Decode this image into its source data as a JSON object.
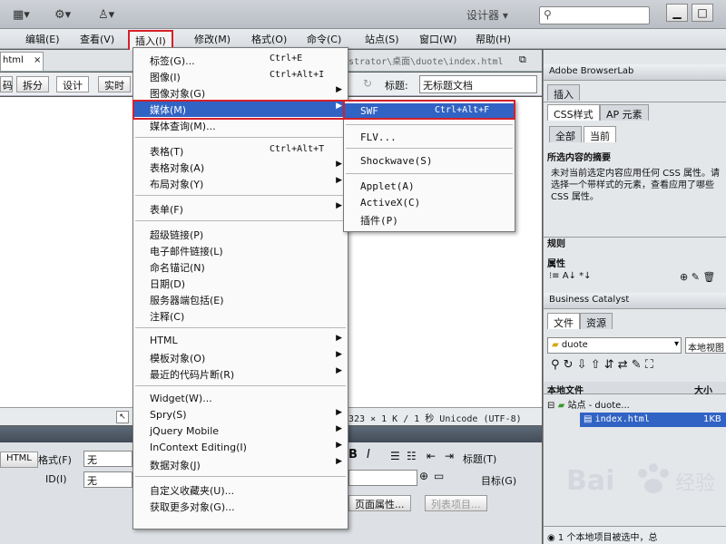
{
  "titlebar": {
    "designer": "设计器"
  },
  "menubar": {
    "items": [
      "编辑(E)",
      "查看(V)",
      "插入(I)",
      "修改(M)",
      "格式(O)",
      "命令(C)",
      "站点(S)",
      "窗口(W)",
      "帮助(H)"
    ]
  },
  "docbar": {
    "tab": "html",
    "path": "strator\\桌面\\duote\\index.html"
  },
  "toolbar": {
    "split": "拆分",
    "design": "设计",
    "live": "实时",
    "title_label": "标题:",
    "title_value": "无标题文档"
  },
  "statusbar": {
    "text": "323 × 1 K / 1 秒 Unicode (UTF-8)"
  },
  "properties": {
    "html_btn": "HTML",
    "format_label": "格式(F)",
    "format_value": "无",
    "id_label": "ID(I)",
    "id_value": "无",
    "bold": "B",
    "italic": "I",
    "title_label": "标题(T)",
    "target_label": "目标(G)",
    "page_props": "页面属性...",
    "list_item": "列表项目..."
  },
  "insert_menu": {
    "items": [
      {
        "label": "标签(G)...",
        "shortcut": "Ctrl+E"
      },
      {
        "label": "图像(I)",
        "shortcut": "Ctrl+Alt+I"
      },
      {
        "label": "图像对象(G)",
        "submenu": true
      },
      {
        "label": "媒体(M)",
        "submenu": true,
        "highlight": true
      },
      {
        "label": "媒体查询(M)..."
      },
      {
        "label": "表格(T)",
        "shortcut": "Ctrl+Alt+T"
      },
      {
        "label": "表格对象(A)",
        "submenu": true
      },
      {
        "label": "布局对象(Y)",
        "submenu": true
      },
      {
        "label": "表单(F)",
        "submenu": true
      },
      {
        "label": "超级链接(P)"
      },
      {
        "label": "电子邮件链接(L)"
      },
      {
        "label": "命名锚记(N)"
      },
      {
        "label": "日期(D)"
      },
      {
        "label": "服务器端包括(E)"
      },
      {
        "label": "注释(C)"
      },
      {
        "label": "HTML",
        "submenu": true
      },
      {
        "label": "模板对象(O)",
        "submenu": true
      },
      {
        "label": "最近的代码片断(R)",
        "submenu": true
      },
      {
        "label": "Widget(W)..."
      },
      {
        "label": "Spry(S)",
        "submenu": true
      },
      {
        "label": "jQuery Mobile",
        "submenu": true
      },
      {
        "label": "InContext Editing(I)",
        "submenu": true
      },
      {
        "label": "数据对象(J)",
        "submenu": true
      },
      {
        "label": "自定义收藏夹(U)..."
      },
      {
        "label": "获取更多对象(G)..."
      }
    ]
  },
  "media_submenu": {
    "items": [
      {
        "label": "SWF",
        "shortcut": "Ctrl+Alt+F",
        "highlight": true
      },
      {
        "label": "FLV..."
      },
      {
        "label": "Shockwave(S)"
      },
      {
        "label": "Applet(A)"
      },
      {
        "label": "ActiveX(C)"
      },
      {
        "label": "插件(P)"
      }
    ]
  },
  "rpanel": {
    "browserlab": "Adobe BrowserLab",
    "insert_tab": "插入",
    "css_tab": "CSS样式",
    "ap_tab": "AP 元素",
    "all_tab": "全部",
    "current_tab": "当前",
    "summary_title": "所选内容的摘要",
    "summary_text": "未对当前选定内容应用任何 CSS 属性。请选择一个带样式的元素，查看应用了哪些 CSS 属性。",
    "rules": "规则",
    "props": "属性",
    "bc": "Business Catalyst",
    "files_tab": "文件",
    "assets_tab": "资源",
    "site": "duote",
    "view": "本地视图",
    "col_local": "本地文件",
    "col_size": "大小",
    "tree_site": "站点 - duote...",
    "tree_file": "index.html",
    "tree_size": "1KB",
    "footer": "1 个本地项目被选中，总"
  },
  "watermark": {
    "text": "Bai",
    "cn": "经验"
  }
}
